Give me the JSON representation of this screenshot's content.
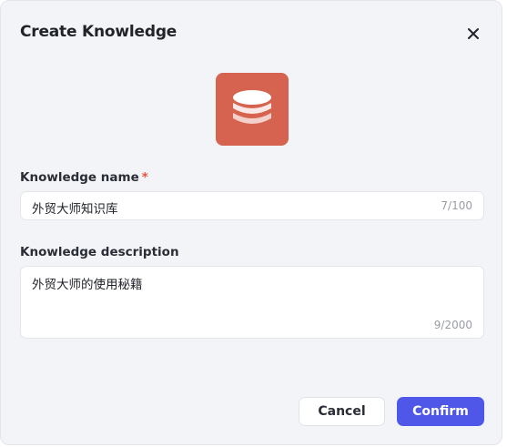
{
  "dialog": {
    "title": "Create Knowledge",
    "close_icon": "close-icon",
    "header_icon": "database-icon",
    "accent_color": "#d5634f"
  },
  "form": {
    "name_label": "Knowledge name",
    "name_required_mark": "*",
    "name_value": "外贸大师知识库",
    "name_counter": "7/100",
    "description_label": "Knowledge description",
    "description_value": "外贸大师的使用秘籍",
    "description_counter": "9/2000"
  },
  "actions": {
    "cancel_label": "Cancel",
    "confirm_label": "Confirm",
    "confirm_color": "#4f57e8"
  }
}
